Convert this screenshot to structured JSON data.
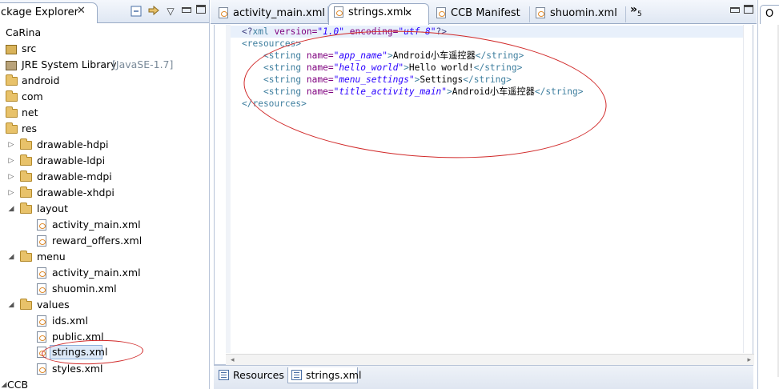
{
  "package_explorer": {
    "title": "ckage Explorer",
    "close_glyph": "✕",
    "toolbar": {
      "collapse_icon": "collapse-all-icon",
      "link_icon": "link-editor-icon",
      "menu_glyph": "▽"
    },
    "tree": {
      "project": "CaRina",
      "src": "src",
      "jre": "JRE System Library",
      "jre_version": "[JavaSE-1.7]",
      "android": "android",
      "com": "com",
      "net": "net",
      "res": "res",
      "drawable_hdpi": "drawable-hdpi",
      "drawable_ldpi": "drawable-ldpi",
      "drawable_mdpi": "drawable-mdpi",
      "drawable_xhdpi": "drawable-xhdpi",
      "layout": "layout",
      "layout_activity_main": "activity_main.xml",
      "layout_reward_offers": "reward_offers.xml",
      "menu": "menu",
      "menu_activity_main": "activity_main.xml",
      "menu_shuomin": "shuomin.xml",
      "values": "values",
      "values_ids": "ids.xml",
      "values_public": "public.xml",
      "values_strings": "strings.xml",
      "values_styles": "styles.xml",
      "ccb": "CCB"
    },
    "arrow_collapsed": "▷",
    "arrow_expanded": "◢"
  },
  "editor": {
    "tabs": {
      "t1": "activity_main.xml",
      "t2": "strings.xml",
      "t2_close": "✕",
      "t3": "CCB Manifest",
      "t4": "shuomin.xml",
      "overflow": "»",
      "overflow_count": "5"
    },
    "code": {
      "l1": {
        "open": "<?",
        "kw": "xml",
        "a1": " version=",
        "v1": "\"1.0\"",
        "a2": " encoding=",
        "v2": "\"utf-8\"",
        "close": "?>"
      },
      "l2": {
        "tag": "<resources>"
      },
      "l3": {
        "open": "<string",
        "attr": " name=",
        "val": "\"app_name\"",
        "gt": ">",
        "text": "Android小车遥控器",
        "end": "</string>"
      },
      "l4": {
        "open": "<string",
        "attr": " name=",
        "val": "\"hello_world\"",
        "gt": ">",
        "text": "Hello world!",
        "end": "</string>"
      },
      "l5": {
        "open": "<string",
        "attr": " name=",
        "val": "\"menu_settings\"",
        "gt": ">",
        "text": "Settings",
        "end": "</string>"
      },
      "l6": {
        "open": "<string",
        "attr": " name=",
        "val": "\"title_activity_main\"",
        "gt": ">",
        "text": "Android小车遥控器",
        "end": "</string>"
      },
      "l7": {
        "tag": "</resources>"
      }
    },
    "bottom_tabs": {
      "resources": "Resources",
      "strings": "strings.xml"
    },
    "scroll_left": "◂",
    "scroll_right": "▸"
  },
  "right_panel": {
    "tab_label": "O"
  },
  "colors": {
    "annotation_red": "#d12a2a",
    "tag": "#3f7f9f",
    "attribute": "#7f007f",
    "value": "#2a00ff"
  }
}
